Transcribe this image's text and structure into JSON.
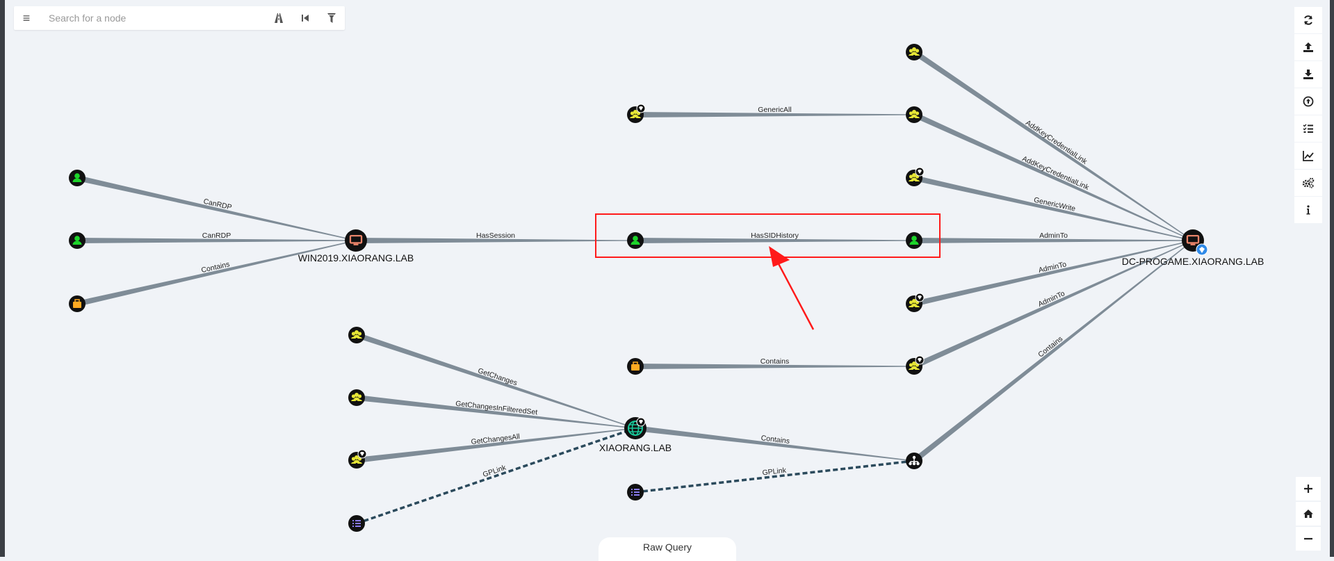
{
  "search": {
    "placeholder": "Search for a node"
  },
  "toolbar": {
    "menu_icon": "menu-icon",
    "pathfinding_icon": "road-icon",
    "back_icon": "step-backward-icon",
    "filter_icon": "filter-icon"
  },
  "right_toolbar": [
    "refresh-icon",
    "upload-icon",
    "download-icon",
    "import-icon",
    "queries-list-icon",
    "chart-icon",
    "settings-icon",
    "info-icon"
  ],
  "zoom": {
    "in": "+",
    "home": "home-icon",
    "out": "−"
  },
  "raw_query": {
    "label": "Raw Query"
  },
  "colors": {
    "group": "#e6e636",
    "user": "#1dd42a",
    "computer": "#e9846a",
    "ou": "#ffaa22",
    "gpo": "#8a7cf0",
    "domain": "#19c89a",
    "edge": "#7f8c97",
    "dashed_edge": "#2b4a5c",
    "highlight": "#ff0000"
  },
  "nodes": {
    "n_u1": {
      "type": "user",
      "label": ""
    },
    "n_u2": {
      "type": "user",
      "label": ""
    },
    "n_ou1": {
      "type": "ou",
      "label": ""
    },
    "n_win": {
      "type": "computer",
      "label": "WIN2019.XIAORANG.LAB"
    },
    "n_g1": {
      "type": "group",
      "label": "",
      "badge": true
    },
    "n_hu1": {
      "type": "user",
      "label": ""
    },
    "n_ou2": {
      "type": "ou",
      "label": ""
    },
    "n_dom": {
      "type": "domain",
      "label": "XIAORANG.LAB",
      "badge": true
    },
    "n_gpo2": {
      "type": "gpo",
      "label": ""
    },
    "n_gg1": {
      "type": "group",
      "label": ""
    },
    "n_gg2": {
      "type": "group",
      "label": ""
    },
    "n_gg3": {
      "type": "group",
      "label": "",
      "badge": true
    },
    "n_gpo1": {
      "type": "gpo",
      "label": ""
    },
    "n_rg1": {
      "type": "group",
      "label": ""
    },
    "n_rg2": {
      "type": "group",
      "label": ""
    },
    "n_rg3": {
      "type": "group",
      "label": "",
      "badge": true
    },
    "n_hu2": {
      "type": "user",
      "label": ""
    },
    "n_rg4": {
      "type": "group",
      "label": "",
      "badge": true
    },
    "n_rg5": {
      "type": "group",
      "label": "",
      "badge": true
    },
    "n_ouR": {
      "type": "ouwhite",
      "label": ""
    },
    "n_dc": {
      "type": "computer",
      "label": "DC-PROGAME.XIAORANG.LAB",
      "badge": true
    }
  },
  "edges": [
    {
      "label": "CanRDP",
      "from": "n_u1",
      "to": "n_win"
    },
    {
      "label": "CanRDP",
      "from": "n_u2",
      "to": "n_win"
    },
    {
      "label": "Contains",
      "from": "n_ou1",
      "to": "n_win"
    },
    {
      "label": "HasSession",
      "from": "n_win",
      "to": "n_hu1"
    },
    {
      "label": "GenericAll",
      "from": "n_g1",
      "to": "n_rg2"
    },
    {
      "label": "HasSIDHistory",
      "from": "n_hu1",
      "to": "n_hu2"
    },
    {
      "label": "Contains",
      "from": "n_ou2",
      "to": "n_rg5"
    },
    {
      "label": "GetChanges",
      "from": "n_gg1",
      "to": "n_dom"
    },
    {
      "label": "GetChangesInFilteredSet",
      "from": "n_gg2",
      "to": "n_dom"
    },
    {
      "label": "GetChangesAll",
      "from": "n_gg3",
      "to": "n_dom"
    },
    {
      "label": "GPLink",
      "from": "n_gpo1",
      "to": "n_dom",
      "dashed": true
    },
    {
      "label": "Contains",
      "from": "n_dom",
      "to": "n_ouR"
    },
    {
      "label": "GPLink",
      "from": "n_gpo2",
      "to": "n_ouR",
      "dashed": true
    },
    {
      "label": "AddKeyCredentialLink",
      "from": "n_rg1",
      "to": "n_dc"
    },
    {
      "label": "AddKeyCredentialLink",
      "from": "n_rg2",
      "to": "n_dc"
    },
    {
      "label": "GenericWrite",
      "from": "n_rg3",
      "to": "n_dc"
    },
    {
      "label": "AdminTo",
      "from": "n_hu2",
      "to": "n_dc"
    },
    {
      "label": "AdminTo",
      "from": "n_rg4",
      "to": "n_dc"
    },
    {
      "label": "AdminTo",
      "from": "n_rg5",
      "to": "n_dc"
    },
    {
      "label": "Contains",
      "from": "n_ouR",
      "to": "n_dc"
    }
  ]
}
